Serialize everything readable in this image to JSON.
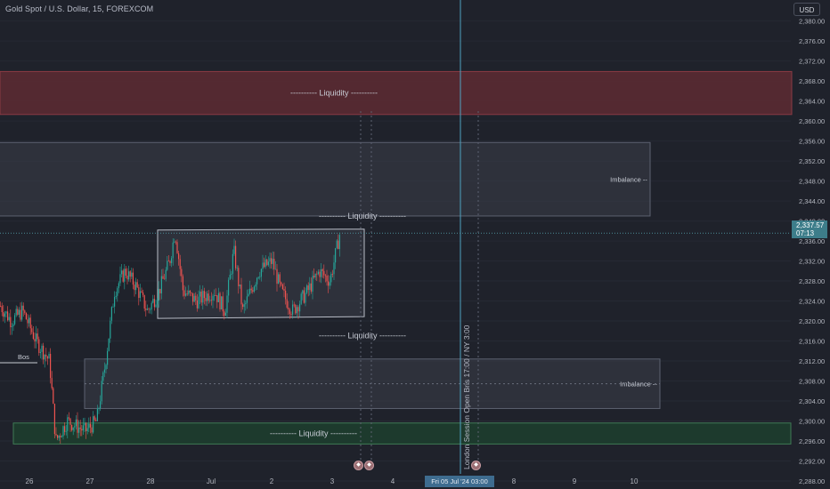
{
  "header": {
    "symbol": "Gold Spot / U.S. Dollar, 15, FOREXCOM"
  },
  "currency_button": {
    "label": "USD"
  },
  "price_badge": {
    "price": "2,337.57",
    "countdown": "07:13"
  },
  "date_badge": {
    "label": "Fri 05 Jul '24   03:00"
  },
  "session_label": "London Session Open Bris 17:00 / NY 3:00",
  "colors": {
    "background": "#1f222b",
    "bull": "#26a69a",
    "bear": "#ef5350",
    "liquidity_red": "#5a2a32",
    "liquidity_green": "#1d3d2e",
    "imbalance": "#3a3e49",
    "session_line": "#4fa3c2"
  },
  "event_icon": "calendar-event-icon",
  "chart_data": {
    "type": "candlestick",
    "ylim": [
      2286.4,
      2384.2
    ],
    "y_ticks": [
      2288,
      2292,
      2296,
      2300,
      2304,
      2308,
      2312,
      2316,
      2320,
      2324,
      2328,
      2332,
      2336,
      2340,
      2344,
      2348,
      2352,
      2356,
      2360,
      2364,
      2368,
      2372,
      2376,
      2380
    ],
    "x_ticks": [
      "26",
      "27",
      "28",
      "Jul",
      "2",
      "3",
      "4",
      "5",
      "8",
      "9",
      "10"
    ],
    "last_price": 2337.57,
    "zones": [
      {
        "label": "---------- Liquidity ----------",
        "top": 2369.9,
        "bottom": 2361.3,
        "kind": "liquidity-red"
      },
      {
        "label": "Imbalance --",
        "top": 2355.7,
        "bottom": 2341.0,
        "kind": "imbalance"
      },
      {
        "label": "Imbalance --",
        "top": 2312.4,
        "bottom": 2302.5,
        "kind": "imbalance"
      },
      {
        "label": "---------- Liquidity ----------",
        "top": 2299.6,
        "bottom": 2295.4,
        "kind": "liquidity-green"
      }
    ],
    "range_box": {
      "top": 2338.2,
      "bottom": 2320.7
    },
    "annotations": [
      {
        "label": "---------- Liquidity ----------",
        "price": 2341.0
      },
      {
        "label": "---------- Liquidity ----------",
        "price": 2317.1
      },
      {
        "label": "Bos",
        "price": 2312.0
      }
    ]
  }
}
